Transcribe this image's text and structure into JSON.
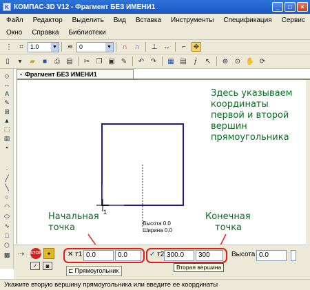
{
  "window": {
    "title": "КОМПАС-3D V12 - Фрагмент БЕЗ ИМЕНИ1"
  },
  "menu": {
    "row1": [
      "Файл",
      "Редактор",
      "Выделить",
      "Вид",
      "Вставка",
      "Инструменты",
      "Спецификация",
      "Сервис"
    ],
    "row2": [
      "Окно",
      "Справка",
      "Библиотеки"
    ]
  },
  "toolbar": {
    "scale_value": "1.0",
    "layer_value": "0"
  },
  "document": {
    "tab_title": "Фрагмент БЕЗ ИМЕНИ1"
  },
  "canvas": {
    "annotation_top": [
      "Здесь указываем",
      "координаты",
      "первой и второй",
      "вершин",
      "прямоугольника"
    ],
    "label_start": [
      "Начальная",
      "точка"
    ],
    "label_end": [
      "Конечная",
      "точка"
    ],
    "corner_number": "1",
    "tooltip_height": "Высота 0.0",
    "tooltip_width": "Ширина 0.0"
  },
  "properties": {
    "t1_label": "т1",
    "t1_x": "0.0",
    "t1_y": "0.0",
    "t2_label": "т2",
    "t2_x": "300.0",
    "t2_y": "300",
    "height_label": "Высота",
    "height_value": "0.0",
    "hint": "Вторая вершина",
    "tab_label": "Прямоугольник"
  },
  "status": {
    "text": "Укажите вторую вершину прямоугольника или введите ее координаты"
  },
  "colors": {
    "annotation": "#0a6d1f",
    "highlight": "#e21b1b",
    "rectangle": "#1c1c8c"
  }
}
